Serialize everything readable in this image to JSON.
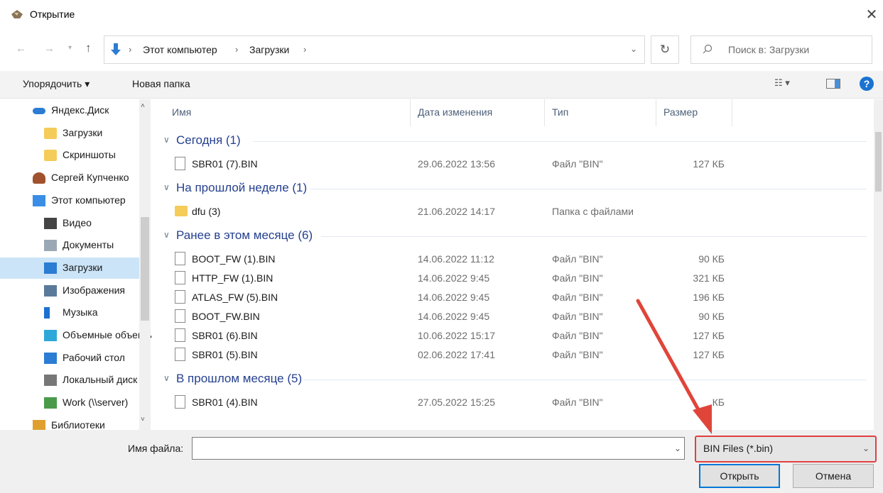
{
  "window": {
    "title": "Открытие",
    "close_glyph": "✕"
  },
  "nav": {
    "back_glyph": "←",
    "forward_glyph": "→",
    "recent_glyph": "▾",
    "up_glyph": "↑",
    "breadcrumb": [
      "Этот компьютер",
      "Загрузки"
    ],
    "sep_glyph": "›",
    "dropdown_glyph": "⌄",
    "refresh_glyph": "↻",
    "search_placeholder": "Поиск в: Загрузки"
  },
  "toolbar": {
    "organize_label": "Упорядочить ▾",
    "new_folder_label": "Новая папка",
    "view_label": "☷ ▾",
    "help_label": "?"
  },
  "sidebar": {
    "items": [
      {
        "label": "Яндекс.Диск",
        "icon": "cloud-icon"
      },
      {
        "label": "Загрузки",
        "icon": "folder-icon"
      },
      {
        "label": "Скриншоты",
        "icon": "folder-icon"
      },
      {
        "label": "Сергей Купченко",
        "icon": "user-icon"
      },
      {
        "label": "Этот компьютер",
        "icon": "computer-icon"
      },
      {
        "label": "Видео",
        "icon": "video-icon"
      },
      {
        "label": "Документы",
        "icon": "documents-icon"
      },
      {
        "label": "Загрузки",
        "icon": "download-icon"
      },
      {
        "label": "Изображения",
        "icon": "pictures-icon"
      },
      {
        "label": "Музыка",
        "icon": "music-icon"
      },
      {
        "label": "Объемные объекты",
        "icon": "3d-objects-icon"
      },
      {
        "label": "Рабочий стол",
        "icon": "desktop-icon"
      },
      {
        "label": "Локальный диск",
        "icon": "drive-icon"
      },
      {
        "label": "Work (\\\\server)",
        "icon": "network-drive-icon"
      },
      {
        "label": "Библиотеки",
        "icon": "libraries-icon"
      }
    ],
    "up_arrow": "˄",
    "down_arrow": "˅"
  },
  "columns": {
    "name": "Имя",
    "date": "Дата изменения",
    "type": "Тип",
    "size": "Размер"
  },
  "groups": [
    {
      "label": "Сегодня (1)",
      "files": [
        {
          "name": "SBR01 (7).BIN",
          "date": "29.06.2022 13:56",
          "type": "Файл \"BIN\"",
          "size": "127 КБ",
          "kind": "file"
        }
      ]
    },
    {
      "label": "На прошлой неделе (1)",
      "files": [
        {
          "name": "dfu (3)",
          "date": "21.06.2022 14:17",
          "type": "Папка с файлами",
          "size": "",
          "kind": "folder"
        }
      ]
    },
    {
      "label": "Ранее в этом месяце (6)",
      "files": [
        {
          "name": "BOOT_FW (1).BIN",
          "date": "14.06.2022 11:12",
          "type": "Файл \"BIN\"",
          "size": "90 КБ",
          "kind": "file"
        },
        {
          "name": "HTTP_FW (1).BIN",
          "date": "14.06.2022 9:45",
          "type": "Файл \"BIN\"",
          "size": "321 КБ",
          "kind": "file"
        },
        {
          "name": "ATLAS_FW (5).BIN",
          "date": "14.06.2022 9:45",
          "type": "Файл \"BIN\"",
          "size": "196 КБ",
          "kind": "file"
        },
        {
          "name": "BOOT_FW.BIN",
          "date": "14.06.2022 9:45",
          "type": "Файл \"BIN\"",
          "size": "90 КБ",
          "kind": "file"
        },
        {
          "name": "SBR01 (6).BIN",
          "date": "10.06.2022 15:17",
          "type": "Файл \"BIN\"",
          "size": "127 КБ",
          "kind": "file"
        },
        {
          "name": "SBR01 (5).BIN",
          "date": "02.06.2022 17:41",
          "type": "Файл \"BIN\"",
          "size": "127 КБ",
          "kind": "file"
        }
      ]
    },
    {
      "label": "В прошлом месяце (5)",
      "files": [
        {
          "name": "SBR01 (4).BIN",
          "date": "27.05.2022 15:25",
          "type": "Файл \"BIN\"",
          "size": "КБ",
          "kind": "file"
        }
      ]
    }
  ],
  "bottom": {
    "filename_label": "Имя файла:",
    "filename_value": "",
    "filter_value": "BIN Files (*.bin)",
    "dropdown_glyph": "⌄",
    "open_label": "Открыть",
    "cancel_label": "Отмена"
  },
  "colors": {
    "accent": "#0078d7",
    "highlight": "#e04040",
    "selected_nav": "#cce4f7"
  }
}
